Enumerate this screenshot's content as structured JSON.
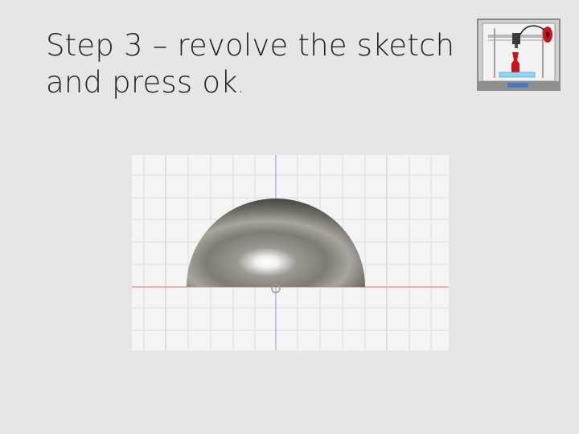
{
  "slide": {
    "title_line1": "Step 3 – revolve the sketch",
    "title_line2": "and press ok",
    "title_period": "."
  },
  "logo": {
    "icon": "3d-printer-icon",
    "frame_color": "#8a8a8a",
    "filament_color": "#c8151b",
    "bed_color": "#8fd3f5"
  },
  "viewport": {
    "icon": "hemisphere-model",
    "grid_color": "#dcdcdc",
    "x_axis_color": "#f08a80",
    "y_axis_color": "#9aa0e0",
    "model_color": "#7a7772"
  }
}
